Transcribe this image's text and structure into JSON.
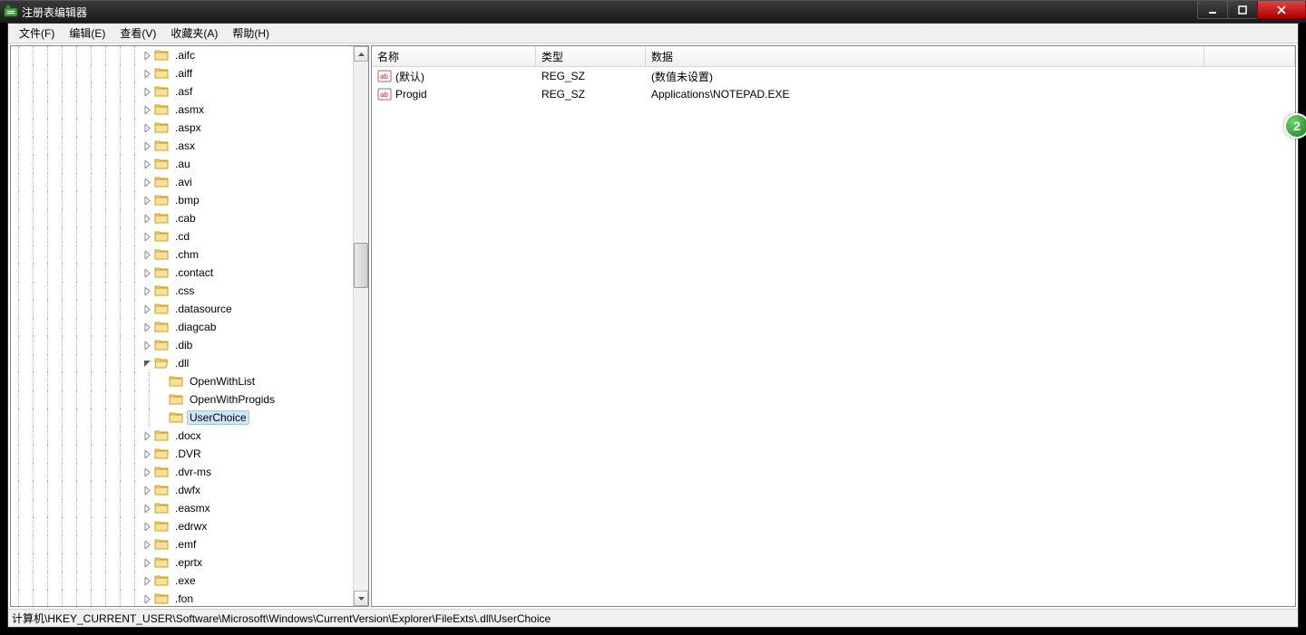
{
  "window": {
    "title": "注册表编辑器"
  },
  "menu": {
    "file": "文件(F)",
    "edit": "编辑(E)",
    "view": "查看(V)",
    "favorites": "收藏夹(A)",
    "help": "帮助(H)"
  },
  "tree": {
    "items": [
      {
        "depth": 10,
        "label": ".aifc",
        "expander": "closed"
      },
      {
        "depth": 10,
        "label": ".aiff",
        "expander": "closed"
      },
      {
        "depth": 10,
        "label": ".asf",
        "expander": "closed"
      },
      {
        "depth": 10,
        "label": ".asmx",
        "expander": "closed"
      },
      {
        "depth": 10,
        "label": ".aspx",
        "expander": "closed"
      },
      {
        "depth": 10,
        "label": ".asx",
        "expander": "closed"
      },
      {
        "depth": 10,
        "label": ".au",
        "expander": "closed"
      },
      {
        "depth": 10,
        "label": ".avi",
        "expander": "closed"
      },
      {
        "depth": 10,
        "label": ".bmp",
        "expander": "closed"
      },
      {
        "depth": 10,
        "label": ".cab",
        "expander": "closed"
      },
      {
        "depth": 10,
        "label": ".cd",
        "expander": "closed"
      },
      {
        "depth": 10,
        "label": ".chm",
        "expander": "closed"
      },
      {
        "depth": 10,
        "label": ".contact",
        "expander": "closed"
      },
      {
        "depth": 10,
        "label": ".css",
        "expander": "closed"
      },
      {
        "depth": 10,
        "label": ".datasource",
        "expander": "closed"
      },
      {
        "depth": 10,
        "label": ".diagcab",
        "expander": "closed"
      },
      {
        "depth": 10,
        "label": ".dib",
        "expander": "closed"
      },
      {
        "depth": 10,
        "label": ".dll",
        "expander": "open"
      },
      {
        "depth": 11,
        "label": "OpenWithList",
        "expander": "none"
      },
      {
        "depth": 11,
        "label": "OpenWithProgids",
        "expander": "none"
      },
      {
        "depth": 11,
        "label": "UserChoice",
        "expander": "none",
        "selected": true
      },
      {
        "depth": 10,
        "label": ".docx",
        "expander": "closed"
      },
      {
        "depth": 10,
        "label": ".DVR",
        "expander": "closed"
      },
      {
        "depth": 10,
        "label": ".dvr-ms",
        "expander": "closed"
      },
      {
        "depth": 10,
        "label": ".dwfx",
        "expander": "closed"
      },
      {
        "depth": 10,
        "label": ".easmx",
        "expander": "closed"
      },
      {
        "depth": 10,
        "label": ".edrwx",
        "expander": "closed"
      },
      {
        "depth": 10,
        "label": ".emf",
        "expander": "closed"
      },
      {
        "depth": 10,
        "label": ".eprtx",
        "expander": "closed"
      },
      {
        "depth": 10,
        "label": ".exe",
        "expander": "closed"
      },
      {
        "depth": 10,
        "label": ".fon",
        "expander": "closed"
      }
    ]
  },
  "list": {
    "columns": {
      "name": "名称",
      "type": "类型",
      "data": "数据"
    },
    "rows": [
      {
        "name": "(默认)",
        "type": "REG_SZ",
        "data": "(数值未设置)"
      },
      {
        "name": "Progid",
        "type": "REG_SZ",
        "data": "Applications\\NOTEPAD.EXE"
      }
    ]
  },
  "statusbar": {
    "path": "计算机\\HKEY_CURRENT_USER\\Software\\Microsoft\\Windows\\CurrentVersion\\Explorer\\FileExts\\.dll\\UserChoice"
  },
  "badge": {
    "text": "2"
  }
}
